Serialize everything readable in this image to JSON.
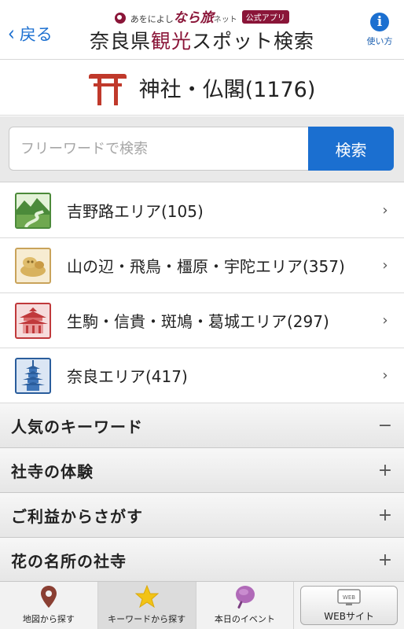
{
  "header": {
    "back_label": "戻る",
    "brand_prefix": "あをによし",
    "brand_main": "なら旅",
    "brand_net": "ネット",
    "badge": "公式アプリ",
    "title_part1": "奈良県",
    "title_accent": "観光",
    "title_part2": "スポット検索",
    "help_label": "使い方",
    "help_icon": "info-icon"
  },
  "category": {
    "icon": "torii-icon",
    "title": "神社・仏閣(1176)"
  },
  "search": {
    "placeholder": "フリーワードで検索",
    "value": "",
    "button_label": "検索"
  },
  "areas": [
    {
      "label": "吉野路エリア(105)",
      "icon": "mountain-river-icon"
    },
    {
      "label": "山の辺・飛鳥・橿原・宇陀エリア(357)",
      "icon": "stone-figure-icon"
    },
    {
      "label": "生駒・信貴・斑鳩・葛城エリア(297)",
      "icon": "temple-hall-icon"
    },
    {
      "label": "奈良エリア(417)",
      "icon": "pagoda-icon"
    }
  ],
  "accordion": [
    {
      "label": "人気のキーワード",
      "sign": "−"
    },
    {
      "label": "社寺の体験",
      "sign": "+"
    },
    {
      "label": "ご利益からさがす",
      "sign": "+"
    },
    {
      "label": "花の名所の社寺",
      "sign": "+"
    }
  ],
  "tabs": [
    {
      "label": "地図から探す",
      "icon": "map-pin-icon"
    },
    {
      "label": "キーワードから探す",
      "icon": "star-icon"
    },
    {
      "label": "本日のイベント",
      "icon": "fan-icon"
    },
    {
      "label": "WEBサイト",
      "icon": "web-icon",
      "icon_text": "WEB"
    }
  ],
  "colors": {
    "accent_blue": "#1b6fd0",
    "brand_maroon": "#8a1538",
    "torii_red": "#c0392b",
    "star_yellow": "#f2c316"
  }
}
